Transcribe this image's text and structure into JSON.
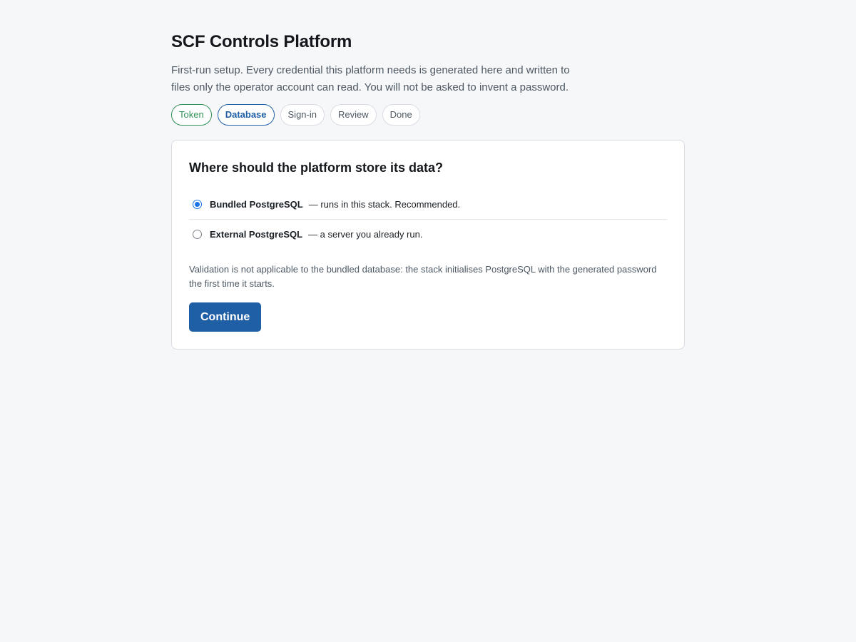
{
  "header": {
    "title": "SCF Controls Platform",
    "intro": "First-run setup. Every credential this platform needs is generated here and written to files only the operator account can read. You will not be asked to invent a password."
  },
  "steps": [
    {
      "label": "Token",
      "state": "done"
    },
    {
      "label": "Database",
      "state": "active"
    },
    {
      "label": "Sign-in",
      "state": "pending"
    },
    {
      "label": "Review",
      "state": "pending"
    },
    {
      "label": "Done",
      "state": "pending"
    }
  ],
  "card": {
    "heading": "Where should the platform store its data?",
    "options": [
      {
        "name": "Bundled PostgreSQL",
        "desc": "— runs in this stack. Recommended.",
        "selected": true
      },
      {
        "name": "External PostgreSQL",
        "desc": "— a server you already run.",
        "selected": false
      }
    ],
    "note": "Validation is not applicable to the bundled database: the stack initialises PostgreSQL with the generated password the first time it starts.",
    "continue_label": "Continue"
  },
  "colors": {
    "accent": "#1f5fa6",
    "done": "#2f8f56",
    "radio": "#1a73e8",
    "background": "#f6f7f9"
  }
}
